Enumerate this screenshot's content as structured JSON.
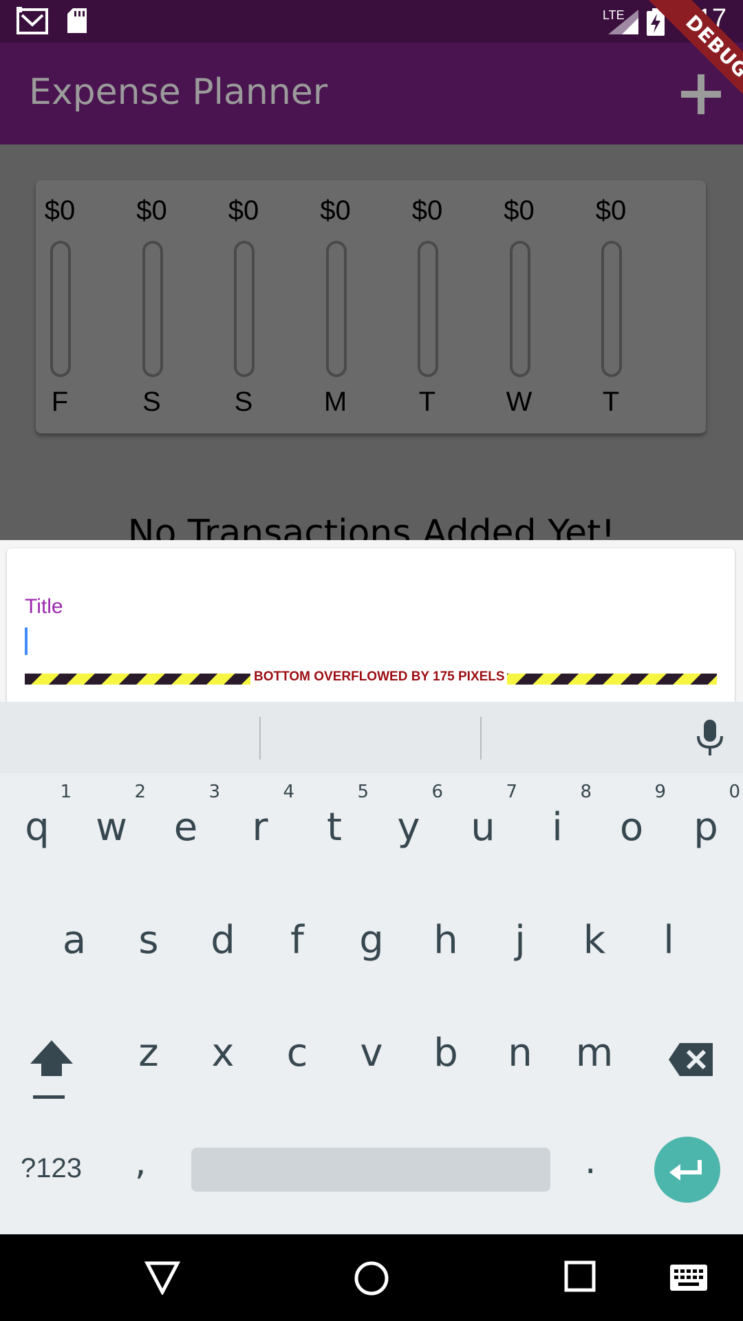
{
  "status_bar": {
    "time": "5:17",
    "network": "LTE"
  },
  "app_bar": {
    "title": "Expense Planner"
  },
  "debug_banner": {
    "label": "DEBUG"
  },
  "chart": {
    "bars": [
      {
        "amount": "$0",
        "day": "F",
        "fraction": 0
      },
      {
        "amount": "$0",
        "day": "S",
        "fraction": 0
      },
      {
        "amount": "$0",
        "day": "S",
        "fraction": 0
      },
      {
        "amount": "$0",
        "day": "M",
        "fraction": 0
      },
      {
        "amount": "$0",
        "day": "T",
        "fraction": 0
      },
      {
        "amount": "$0",
        "day": "W",
        "fraction": 0
      },
      {
        "amount": "$0",
        "day": "T",
        "fraction": 0
      }
    ]
  },
  "empty_message": "No Transactions Added Yet!",
  "form": {
    "title_label": "Title",
    "title_value": "",
    "overflow_warning": "BOTTOM OVERFLOWED BY 175 PIXELS"
  },
  "keyboard": {
    "row1": [
      {
        "key": "q",
        "hint": "1"
      },
      {
        "key": "w",
        "hint": "2"
      },
      {
        "key": "e",
        "hint": "3"
      },
      {
        "key": "r",
        "hint": "4"
      },
      {
        "key": "t",
        "hint": "5"
      },
      {
        "key": "y",
        "hint": "6"
      },
      {
        "key": "u",
        "hint": "7"
      },
      {
        "key": "i",
        "hint": "8"
      },
      {
        "key": "o",
        "hint": "9"
      },
      {
        "key": "p",
        "hint": "0"
      }
    ],
    "row2": [
      "a",
      "s",
      "d",
      "f",
      "g",
      "h",
      "j",
      "k",
      "l"
    ],
    "row3": [
      "z",
      "x",
      "c",
      "v",
      "b",
      "n",
      "m"
    ],
    "num_label": "?123",
    "comma": ",",
    "period": "."
  },
  "colors": {
    "primary": "#4a1450",
    "accent": "#9c27b0",
    "enter": "#4db6ac"
  }
}
